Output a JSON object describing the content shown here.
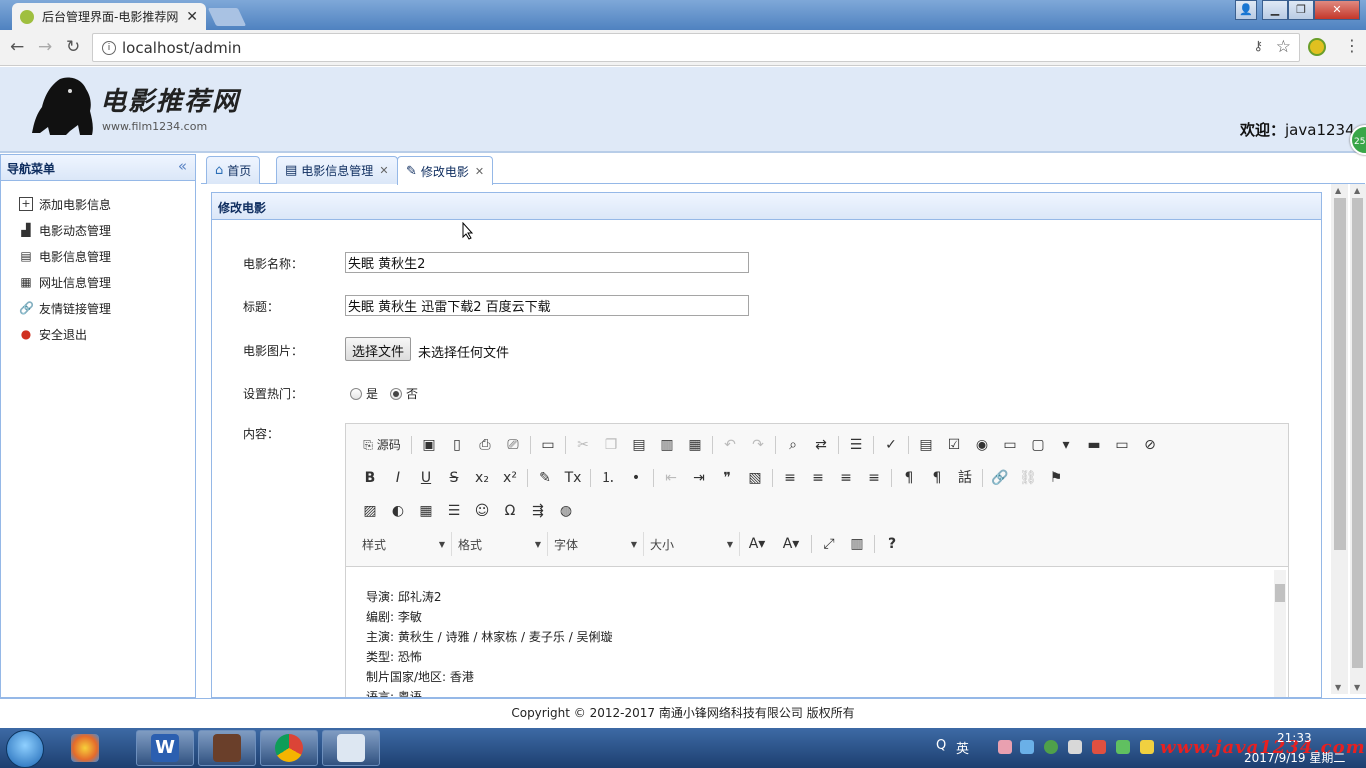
{
  "browser": {
    "tab_title": "后台管理界面-电影推荐网",
    "url": "localhost/admin"
  },
  "header": {
    "logo_title": "电影推荐网",
    "logo_subtitle": "www.film1234.com",
    "welcome_label": "欢迎：",
    "welcome_user": "java1234",
    "badge": "25"
  },
  "leftnav": {
    "title": "导航菜单",
    "items": [
      {
        "label": "添加电影信息",
        "icon": "add-icon"
      },
      {
        "label": "电影动态管理",
        "icon": "chart-icon"
      },
      {
        "label": "电影信息管理",
        "icon": "film-icon"
      },
      {
        "label": "网址信息管理",
        "icon": "table-icon"
      },
      {
        "label": "友情链接管理",
        "icon": "link-icon"
      },
      {
        "label": "安全退出",
        "icon": "exit-icon"
      }
    ]
  },
  "tabs": [
    {
      "label": "首页",
      "icon": "home-icon",
      "closable": false
    },
    {
      "label": "电影信息管理",
      "icon": "film-icon",
      "closable": true
    },
    {
      "label": "修改电影",
      "icon": "edit-icon",
      "closable": true,
      "active": true
    }
  ],
  "form": {
    "panel_title": "修改电影",
    "name_label": "电影名称：",
    "name_value": "失眠 黄秋生2",
    "title_label": "标题：",
    "title_value": "失眠 黄秋生 迅雷下载2 百度云下载",
    "image_label": "电影图片：",
    "file_button": "选择文件",
    "file_status": "未选择任何文件",
    "hot_label": "设置热门：",
    "hot_yes": "是",
    "hot_no": "否",
    "hot_selected": "否",
    "content_label": "内容："
  },
  "editor": {
    "source_label": "源码",
    "combos": [
      "样式",
      "格式",
      "字体",
      "大小"
    ],
    "content_lines": [
      "导演: 邱礼涛2",
      "编剧: 李敏",
      "主演: 黄秋生 / 诗雅 / 林家栋 / 麦子乐 / 吴俐璇",
      "类型: 恐怖",
      "制片国家/地区: 香港",
      "语言: 粤语"
    ]
  },
  "footer": {
    "copyright": "Copyright © 2012-2017 南通小锋网络科技有限公司 版权所有"
  },
  "taskbar": {
    "ime": "Q",
    "lang": "英",
    "time": "21:33",
    "date": "2017/9/19 星期二",
    "watermark": "www.java1234.com"
  }
}
